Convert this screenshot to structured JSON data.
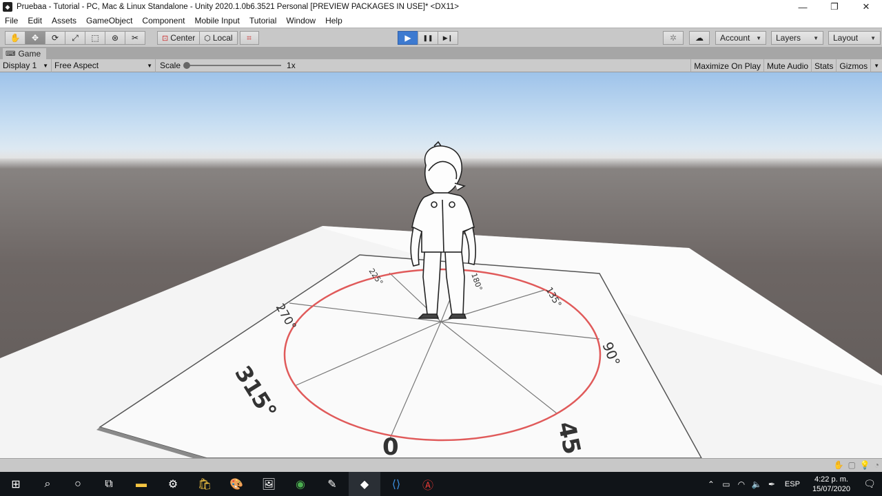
{
  "window": {
    "title": "Pruebaa - Tutorial - PC, Mac & Linux Standalone - Unity 2020.1.0b6.3521 Personal [PREVIEW PACKAGES IN USE]* <DX11>",
    "minimize": "—",
    "restore": "❐",
    "close": "✕"
  },
  "menu": [
    "File",
    "Edit",
    "Assets",
    "GameObject",
    "Component",
    "Mobile Input",
    "Tutorial",
    "Window",
    "Help"
  ],
  "toolbar": {
    "tools": [
      {
        "name": "hand-tool",
        "glyph": "✋"
      },
      {
        "name": "move-tool",
        "glyph": "✥"
      },
      {
        "name": "rotate-tool",
        "glyph": "⟳"
      },
      {
        "name": "scale-tool",
        "glyph": "⤢"
      },
      {
        "name": "rect-tool",
        "glyph": "⬚"
      },
      {
        "name": "transform-tool",
        "glyph": "⊛"
      },
      {
        "name": "custom-tool",
        "glyph": "✂"
      }
    ],
    "pivot_label": "Center",
    "space_label": "Local",
    "play": "▶",
    "pause": "❚❚",
    "step": "▶❙",
    "account_label": "Account",
    "layers_label": "Layers",
    "layout_label": "Layout"
  },
  "game_tab": {
    "label": "Game",
    "display": "Display 1",
    "aspect": "Free Aspect",
    "scale_label": "Scale",
    "scale_value": "1x",
    "maximize_on_play": "Maximize On Play",
    "mute_audio": "Mute Audio",
    "stats": "Stats",
    "gizmos": "Gizmos"
  },
  "scene_labels": {
    "a180": "180°",
    "a135": "135°",
    "a90": "90°",
    "a45": "45",
    "a0": "0",
    "a315": "315°",
    "a270": "270°",
    "a225": "225°"
  },
  "taskbar": {
    "language": "ESP",
    "time": "4:22 p. m.",
    "date": "15/07/2020"
  }
}
